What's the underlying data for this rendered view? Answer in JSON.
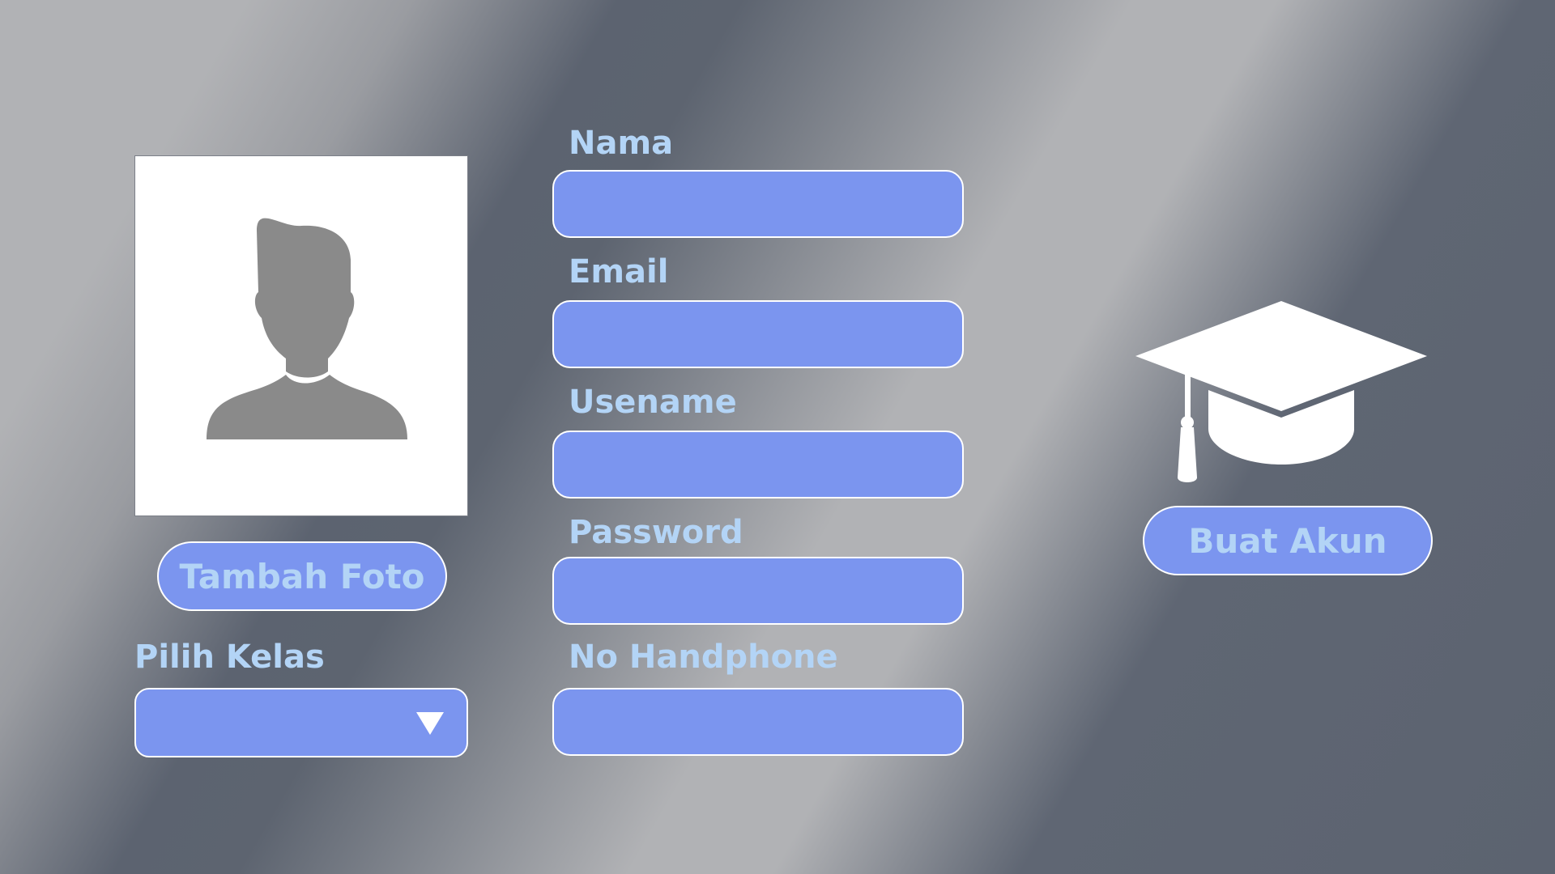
{
  "photo": {
    "add_photo_button": "Tambah Foto",
    "placeholder_icon": "user-silhouette-icon"
  },
  "class_select": {
    "label": "Pilih Kelas",
    "selected_value": "",
    "icon": "dropdown-triangle-icon"
  },
  "form": {
    "fields": [
      {
        "label": "Nama",
        "value": ""
      },
      {
        "label": "Email",
        "value": ""
      },
      {
        "label": "Usename",
        "value": ""
      },
      {
        "label": "Password",
        "value": ""
      },
      {
        "label": "No Handphone",
        "value": ""
      }
    ]
  },
  "actions": {
    "create_account_button": "Buat Akun",
    "icon": "graduation-cap-icon"
  },
  "colors": {
    "field_fill": "#7b95ef",
    "label_text": "#b3d4f6",
    "silhouette": "#8a8a8a"
  }
}
